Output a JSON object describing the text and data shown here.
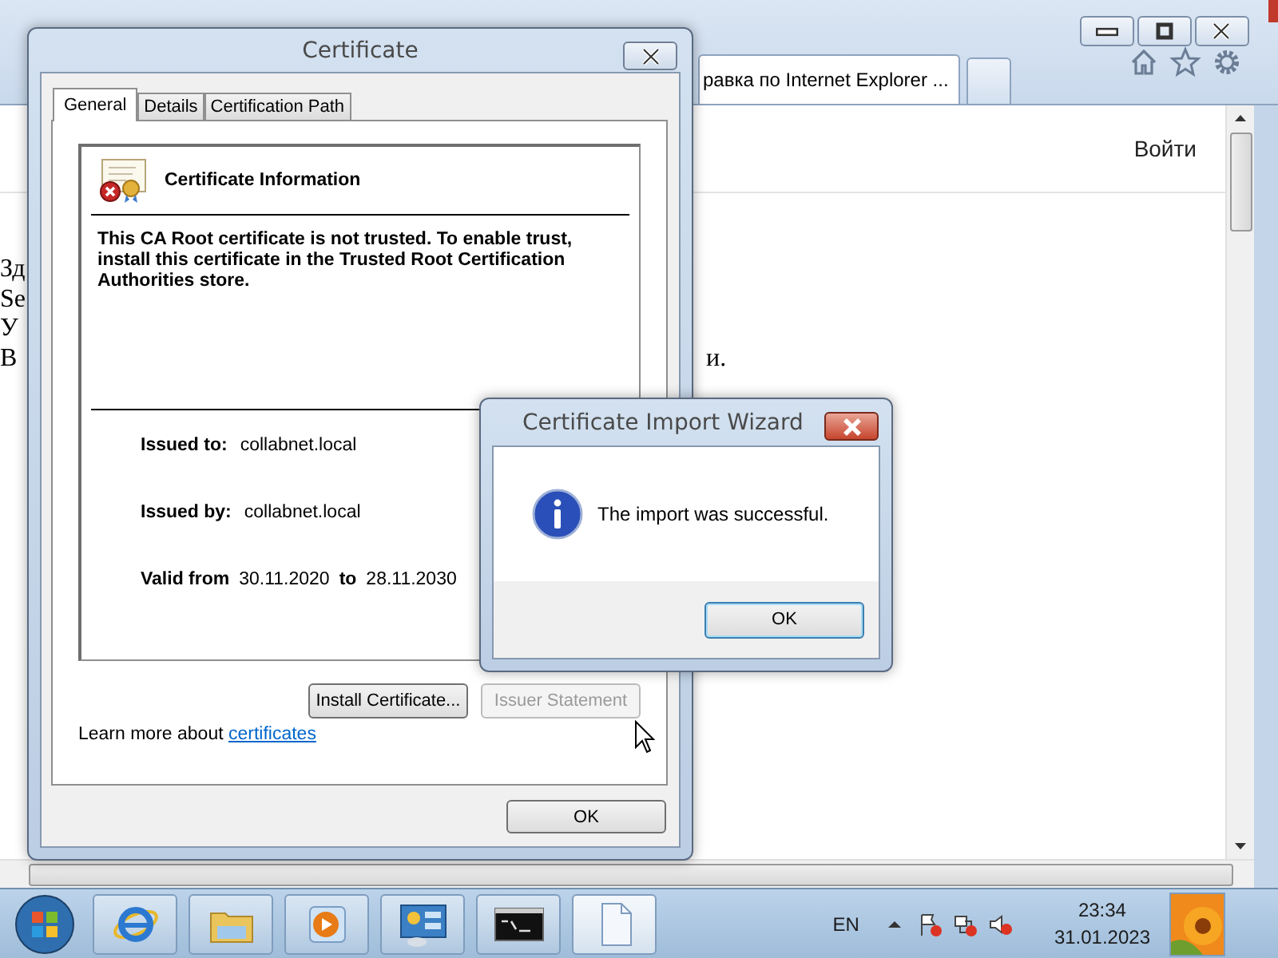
{
  "browser": {
    "tabs": [
      {
        "title": "равка по Internet Explorer ...",
        "selected": true
      }
    ],
    "user_link": "Войти",
    "page_lines": [
      {
        "start": "Зд"
      },
      {
        "start": "Se"
      },
      {
        "start": "У"
      },
      {
        "start": "В",
        "end": "и."
      }
    ]
  },
  "certificate_dialog": {
    "title": "Certificate",
    "tabs": [
      {
        "label": "General",
        "selected": true
      },
      {
        "label": "Details",
        "selected": false
      },
      {
        "label": "Certification Path",
        "selected": false
      }
    ],
    "heading": "Certificate Information",
    "message": "This CA Root certificate is not trusted. To enable trust, install this certificate in the Trusted Root Certification Authorities store.",
    "issued_to": {
      "label": "Issued to:",
      "value": "collabnet.local"
    },
    "issued_by": {
      "label": "Issued by:",
      "value": "collabnet.local"
    },
    "validity": {
      "from_label": "Valid from",
      "from": "30.11.2020",
      "to_label": "to",
      "to": "28.11.2030"
    },
    "buttons": [
      {
        "label": "Install Certificate...",
        "disabled": false
      },
      {
        "label": "Issuer Statement",
        "disabled": true
      }
    ],
    "learn_more": {
      "text": "Learn more about ",
      "link": "certificates"
    },
    "ok": "OK"
  },
  "import_wizard": {
    "title": "Certificate Import Wizard",
    "message": "The import was successful.",
    "ok": "OK"
  },
  "taskbar": {
    "items": [
      {
        "kind": "browser",
        "active": false
      },
      {
        "kind": "folder",
        "active": false
      },
      {
        "kind": "media",
        "active": false
      },
      {
        "kind": "panel",
        "active": false
      },
      {
        "kind": "console",
        "active": false
      },
      {
        "kind": "document",
        "active": true
      }
    ],
    "language": "EN",
    "time": "23:34",
    "date": "31.01.2023"
  }
}
